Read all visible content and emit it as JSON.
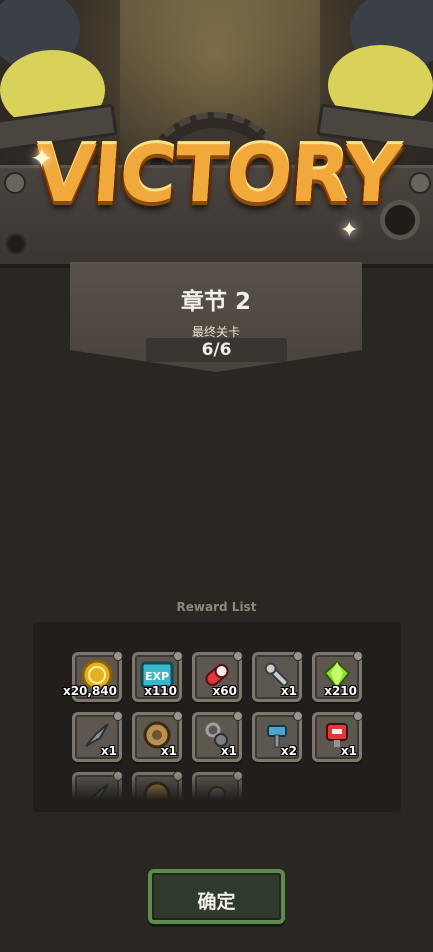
{
  "banner": {
    "title": "VICTORY"
  },
  "chapter": {
    "title": "章节 2",
    "final_stage_label": "最终关卡",
    "final_stage_value": "6/6"
  },
  "rewards": {
    "label": "Reward List",
    "items": [
      {
        "icon": "gold-coin-icon",
        "count": "x20,840"
      },
      {
        "icon": "exp-book-icon",
        "count": "x110"
      },
      {
        "icon": "red-capsule-icon",
        "count": "x60"
      },
      {
        "icon": "wrench-icon",
        "count": "x1"
      },
      {
        "icon": "green-gem-icon",
        "count": "x210"
      },
      {
        "icon": "drill-part-icon",
        "count": "x1"
      },
      {
        "icon": "shield-part-icon",
        "count": "x1"
      },
      {
        "icon": "chain-part-icon",
        "count": "x1"
      },
      {
        "icon": "hammer-part-icon",
        "count": "x2"
      },
      {
        "icon": "red-robot-icon",
        "count": "x1"
      },
      {
        "icon": "drill-part-icon",
        "count": ""
      },
      {
        "icon": "shield-part-icon",
        "count": ""
      },
      {
        "icon": "chain-part-icon",
        "count": ""
      }
    ]
  },
  "confirm_button": {
    "label": "确定"
  },
  "colors": {
    "accent_gold": "#f0a93a",
    "confirm_border": "#5f8a4e",
    "panel_bg": "#211e1b"
  }
}
